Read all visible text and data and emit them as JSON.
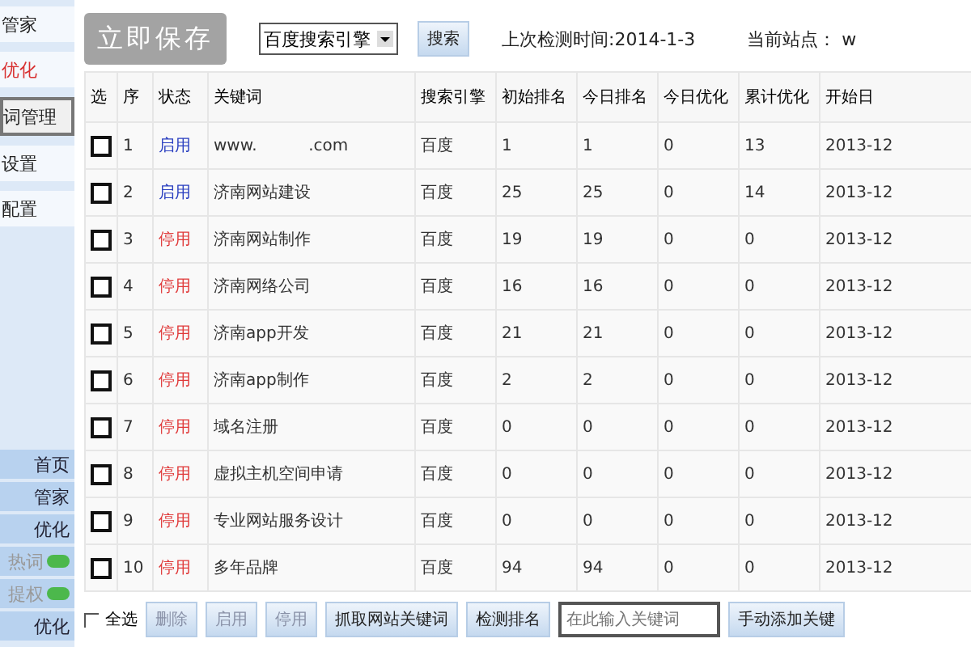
{
  "sidebar": {
    "top_items": [
      {
        "label": "管家",
        "selected": false,
        "highlight": false
      },
      {
        "label": "优化",
        "selected": false,
        "highlight": true
      },
      {
        "label": "词管理",
        "selected": true,
        "highlight": false
      },
      {
        "label": "设置",
        "selected": false,
        "highlight": false
      },
      {
        "label": "配置",
        "selected": false,
        "highlight": false
      }
    ],
    "bottom_items": [
      {
        "label": "首页",
        "disabled": false,
        "badge": false
      },
      {
        "label": "管家",
        "disabled": false,
        "badge": false
      },
      {
        "label": "优化",
        "disabled": false,
        "badge": false
      },
      {
        "label": "热词",
        "disabled": true,
        "badge": true
      },
      {
        "label": "提权",
        "disabled": true,
        "badge": true
      },
      {
        "label": "优化",
        "disabled": false,
        "badge": false
      }
    ]
  },
  "toolbar": {
    "save_button": {
      "label": "立即保存",
      "disabled": true
    },
    "engine_select": {
      "value": "百度搜索引擎"
    },
    "search_button": "搜索",
    "last_check": "上次检测时间:2014-1-3",
    "current_site": "当前站点： w"
  },
  "table": {
    "columns": [
      "选",
      "序",
      "状态",
      "关键词",
      "搜索引擎",
      "初始排名",
      "今日排名",
      "今日优化",
      "累计优化",
      "开始日"
    ],
    "rows": [
      {
        "checked": false,
        "index": "1",
        "status": "启用",
        "active": true,
        "keyword": "www.          .com",
        "engine": "百度",
        "initial": "1",
        "today": "1",
        "today_opt": "0",
        "total_opt": "13",
        "start": "2013-12"
      },
      {
        "checked": false,
        "index": "2",
        "status": "启用",
        "active": true,
        "keyword": "济南网站建设",
        "engine": "百度",
        "initial": "25",
        "today": "25",
        "today_opt": "0",
        "total_opt": "14",
        "start": "2013-12"
      },
      {
        "checked": false,
        "index": "3",
        "status": "停用",
        "active": false,
        "keyword": "济南网站制作",
        "engine": "百度",
        "initial": "19",
        "today": "19",
        "today_opt": "0",
        "total_opt": "0",
        "start": "2013-12"
      },
      {
        "checked": false,
        "index": "4",
        "status": "停用",
        "active": false,
        "keyword": "济南网络公司",
        "engine": "百度",
        "initial": "16",
        "today": "16",
        "today_opt": "0",
        "total_opt": "0",
        "start": "2013-12"
      },
      {
        "checked": false,
        "index": "5",
        "status": "停用",
        "active": false,
        "keyword": "济南app开发",
        "engine": "百度",
        "initial": "21",
        "today": "21",
        "today_opt": "0",
        "total_opt": "0",
        "start": "2013-12"
      },
      {
        "checked": false,
        "index": "6",
        "status": "停用",
        "active": false,
        "keyword": "济南app制作",
        "engine": "百度",
        "initial": "2",
        "today": "2",
        "today_opt": "0",
        "total_opt": "0",
        "start": "2013-12"
      },
      {
        "checked": false,
        "index": "7",
        "status": "停用",
        "active": false,
        "keyword": "域名注册",
        "engine": "百度",
        "initial": "0",
        "today": "0",
        "today_opt": "0",
        "total_opt": "0",
        "start": "2013-12"
      },
      {
        "checked": false,
        "index": "8",
        "status": "停用",
        "active": false,
        "keyword": "虚拟主机空间申请",
        "engine": "百度",
        "initial": "0",
        "today": "0",
        "today_opt": "0",
        "total_opt": "0",
        "start": "2013-12"
      },
      {
        "checked": false,
        "index": "9",
        "status": "停用",
        "active": false,
        "keyword": "专业网站服务设计",
        "engine": "百度",
        "initial": "0",
        "today": "0",
        "today_opt": "0",
        "total_opt": "0",
        "start": "2013-12"
      },
      {
        "checked": false,
        "index": "10",
        "status": "停用",
        "active": false,
        "keyword": "多年品牌",
        "engine": "百度",
        "initial": "94",
        "today": "94",
        "today_opt": "0",
        "total_opt": "0",
        "start": "2013-12"
      }
    ]
  },
  "footer": {
    "select_all": {
      "label": "全选",
      "checked": false
    },
    "buttons": [
      {
        "label": "删除",
        "disabled": true
      },
      {
        "label": "启用",
        "disabled": true
      },
      {
        "label": "停用",
        "disabled": true
      },
      {
        "label": "抓取网站关键词",
        "disabled": false
      },
      {
        "label": "检测排名",
        "disabled": false
      }
    ],
    "keyword_input": {
      "placeholder": "在此输入关键词"
    },
    "add_button": "手动添加关键"
  }
}
